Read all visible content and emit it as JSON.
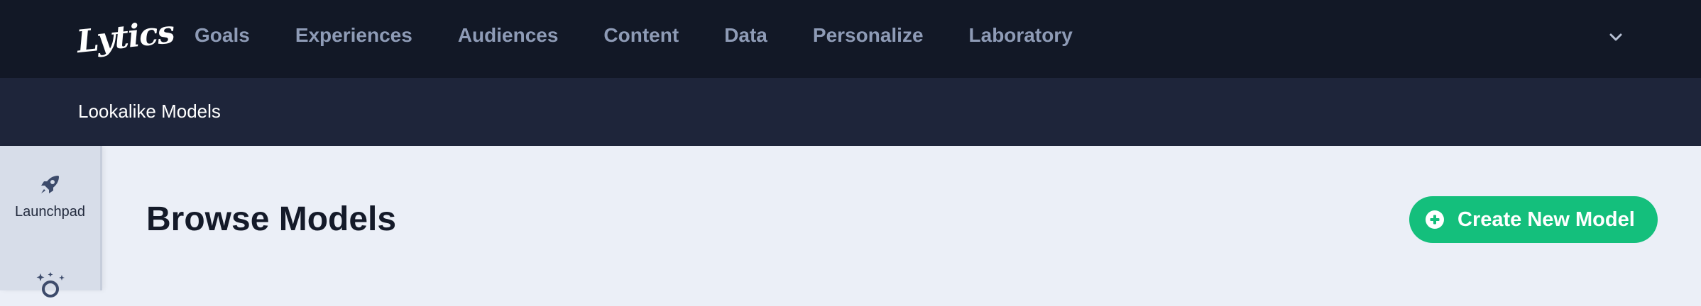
{
  "brand": {
    "logo_text": "Lytics"
  },
  "nav": {
    "items": [
      {
        "label": "Goals"
      },
      {
        "label": "Experiences"
      },
      {
        "label": "Audiences"
      },
      {
        "label": "Content"
      },
      {
        "label": "Data"
      },
      {
        "label": "Personalize"
      },
      {
        "label": "Laboratory"
      }
    ],
    "chevron_icon": "chevron-down-icon"
  },
  "subheader": {
    "title": "Lookalike Models"
  },
  "sidebar": {
    "items": [
      {
        "label": "Launchpad",
        "icon": "rocket-icon"
      },
      {
        "label": "",
        "icon": "sparkle-search-icon"
      }
    ]
  },
  "main": {
    "title": "Browse Models",
    "primary_action": {
      "label": "Create New Model",
      "icon": "plus-circle-icon"
    }
  },
  "colors": {
    "nav_bg": "#121826",
    "subheader_bg": "#1e253a",
    "page_bg": "#ebeff7",
    "sidebar_bg": "#d7dde9",
    "accent": "#14bf7c",
    "nav_text": "#8e9bb6"
  }
}
